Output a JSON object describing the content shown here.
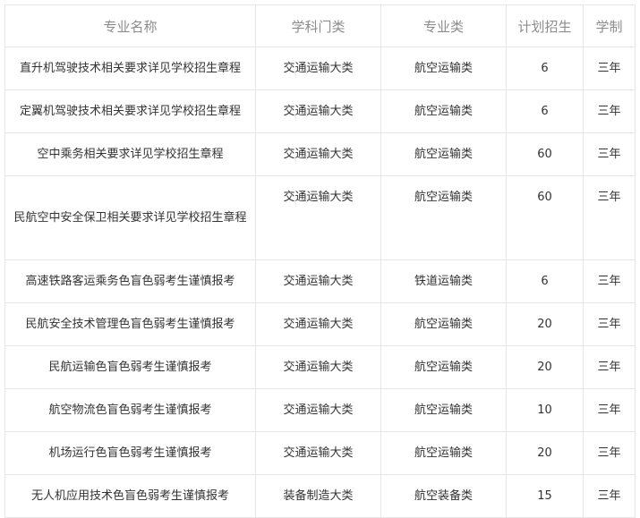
{
  "table": {
    "headers": {
      "name": "专业名称",
      "category": "学科门类",
      "type": "专业类",
      "plan": "计划招生",
      "years": "学制"
    },
    "rows": [
      {
        "name": "直升机驾驶技术相关要求详见学校招生章程",
        "category": "交通运输大类",
        "type": "航空运输类",
        "plan": "6",
        "years": "三年"
      },
      {
        "name": "定翼机驾驶技术相关要求详见学校招生章程",
        "category": "交通运输大类",
        "type": "航空运输类",
        "plan": "6",
        "years": "三年"
      },
      {
        "name": "空中乘务相关要求详见学校招生章程",
        "category": "交通运输大类",
        "type": "航空运输类",
        "plan": "60",
        "years": "三年"
      },
      {
        "name": "民航空中安全保卫相关要求详见学校招生章程",
        "category": "交通运输大类",
        "type": "航空运输类",
        "plan": "60",
        "years": "三年"
      },
      {
        "name": "高速铁路客运乘务色盲色弱考生谨慎报考",
        "category": "交通运输大类",
        "type": "铁道运输类",
        "plan": "6",
        "years": "三年"
      },
      {
        "name": "民航安全技术管理色盲色弱考生谨慎报考",
        "category": "交通运输大类",
        "type": "航空运输类",
        "plan": "20",
        "years": "三年"
      },
      {
        "name": "民航运输色盲色弱考生谨慎报考",
        "category": "交通运输大类",
        "type": "航空运输类",
        "plan": "20",
        "years": "三年"
      },
      {
        "name": "航空物流色盲色弱考生谨慎报考",
        "category": "交通运输大类",
        "type": "航空运输类",
        "plan": "10",
        "years": "三年"
      },
      {
        "name": "机场运行色盲色弱考生谨慎报考",
        "category": "交通运输大类",
        "type": "航空运输类",
        "plan": "20",
        "years": "三年"
      },
      {
        "name": "无人机应用技术色盲色弱考生谨慎报考",
        "category": "装备制造大类",
        "type": "航空装备类",
        "plan": "15",
        "years": "三年"
      }
    ]
  }
}
